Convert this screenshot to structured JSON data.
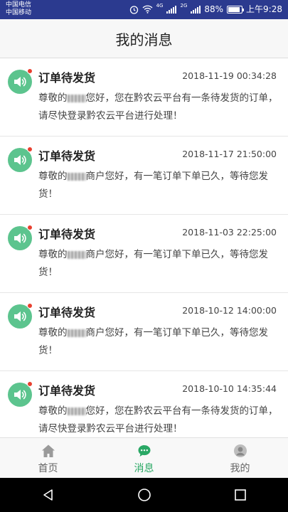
{
  "status_bar": {
    "carrier_1": "中国电信",
    "carrier_2": "中国移动",
    "network_1": "4G",
    "network_2": "2G",
    "battery": "88%",
    "battery_level": 0.88,
    "time": "上午9:28"
  },
  "header": {
    "title": "我的消息"
  },
  "messages": [
    {
      "title": "订单待发货",
      "time": "2018-11-19 00:34:28",
      "body_a": "尊敬的",
      "body_b": "您好，您在黔农云平台有一条待发货的订单，请尽快登录黔农云平台进行处理！"
    },
    {
      "title": "订单待发货",
      "time": "2018-11-17 21:50:00",
      "body_a": "尊敬的",
      "body_b": "商户您好，有一笔订单下单已久，等待您发货！"
    },
    {
      "title": "订单待发货",
      "time": "2018-11-03 22:25:00",
      "body_a": "尊敬的",
      "body_b": "商户您好，有一笔订单下单已久，等待您发货！"
    },
    {
      "title": "订单待发货",
      "time": "2018-10-12 14:00:00",
      "body_a": "尊敬的",
      "body_b": "商户您好，有一笔订单下单已久，等待您发货！"
    },
    {
      "title": "订单待发货",
      "time": "2018-10-10 14:35:44",
      "body_a": "尊敬的",
      "body_b": "您好，您在黔农云平台有一条待发货的订单，请尽快登录黔农云平台进行处理！"
    }
  ],
  "tabs": [
    {
      "label": "首页",
      "icon": "home-icon",
      "active": false
    },
    {
      "label": "消息",
      "icon": "chat-icon",
      "active": true
    },
    {
      "label": "我的",
      "icon": "user-icon",
      "active": false
    }
  ],
  "colors": {
    "status_bar": "#2b3a8f",
    "accent": "#2aa865",
    "avatar": "#5cc48e",
    "unread_dot": "#e8402f"
  }
}
